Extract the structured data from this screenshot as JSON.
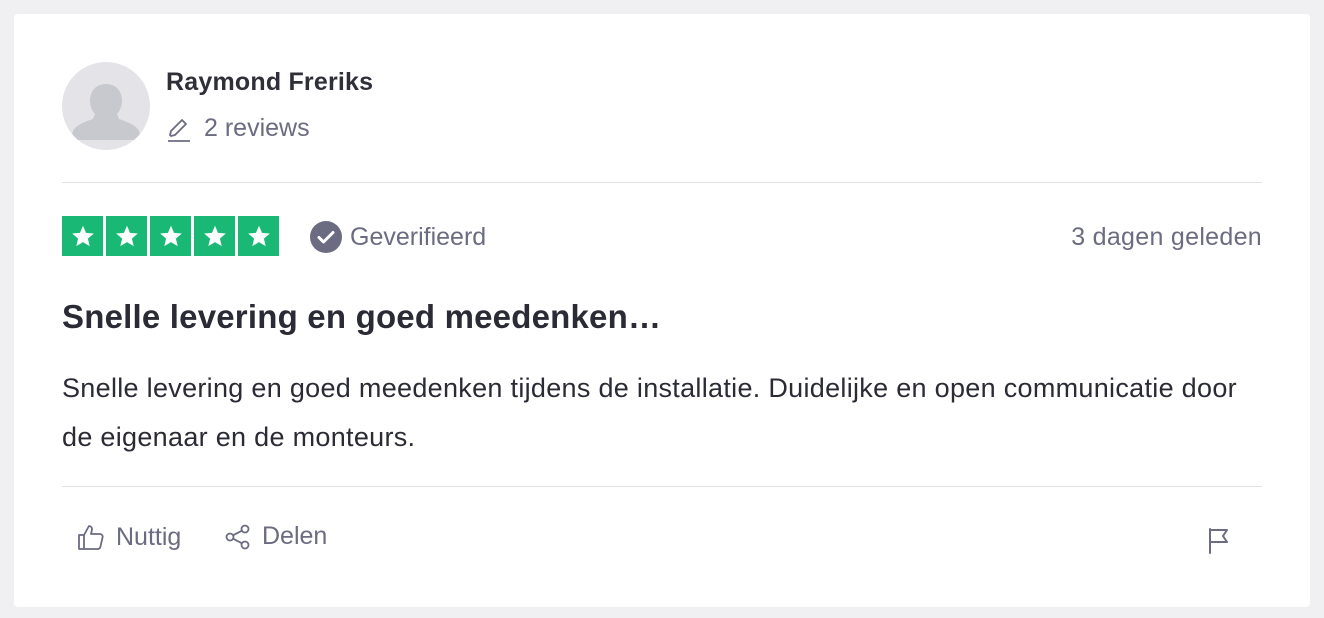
{
  "reviewer": {
    "name": "Raymond Freriks",
    "reviews_count": "2 reviews"
  },
  "review": {
    "rating": 5,
    "rating_max": 5,
    "verified_label": "Geverifieerd",
    "date": "3 dagen geleden",
    "title": "Snelle levering en goed meedenken…",
    "body": "Snelle levering en goed meedenken tijdens de installatie. Duidelijke en open communicatie door de eigenaar en de monteurs."
  },
  "actions": {
    "useful_label": "Nuttig",
    "share_label": "Delen"
  },
  "colors": {
    "star_green": "#1ab875",
    "muted_text": "#6b6b82",
    "verified_badge": "#6b6b82"
  },
  "icons": {
    "avatar": "person-silhouette-icon",
    "reviews": "pencil-icon",
    "verified": "check-circle-icon",
    "useful": "thumbs-up-icon",
    "share": "share-icon",
    "report": "flag-icon"
  }
}
